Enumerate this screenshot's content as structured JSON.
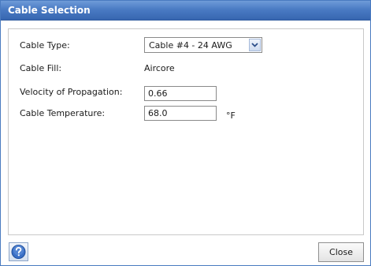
{
  "window": {
    "title": "Cable Selection"
  },
  "form": {
    "cable_type": {
      "label": "Cable Type:",
      "selected": "Cable #4 - 24 AWG"
    },
    "cable_fill": {
      "label": "Cable Fill:",
      "value": "Aircore"
    },
    "velocity": {
      "label": "Velocity of Propagation:",
      "value": "0.66"
    },
    "temperature": {
      "label": "Cable Temperature:",
      "value": "68.0",
      "unit": "°F"
    }
  },
  "footer": {
    "help_icon": "help-question-icon",
    "close_label": "Close"
  },
  "colors": {
    "titlebar": "#4a7bc4",
    "help_icon": "#3a6fc6"
  }
}
